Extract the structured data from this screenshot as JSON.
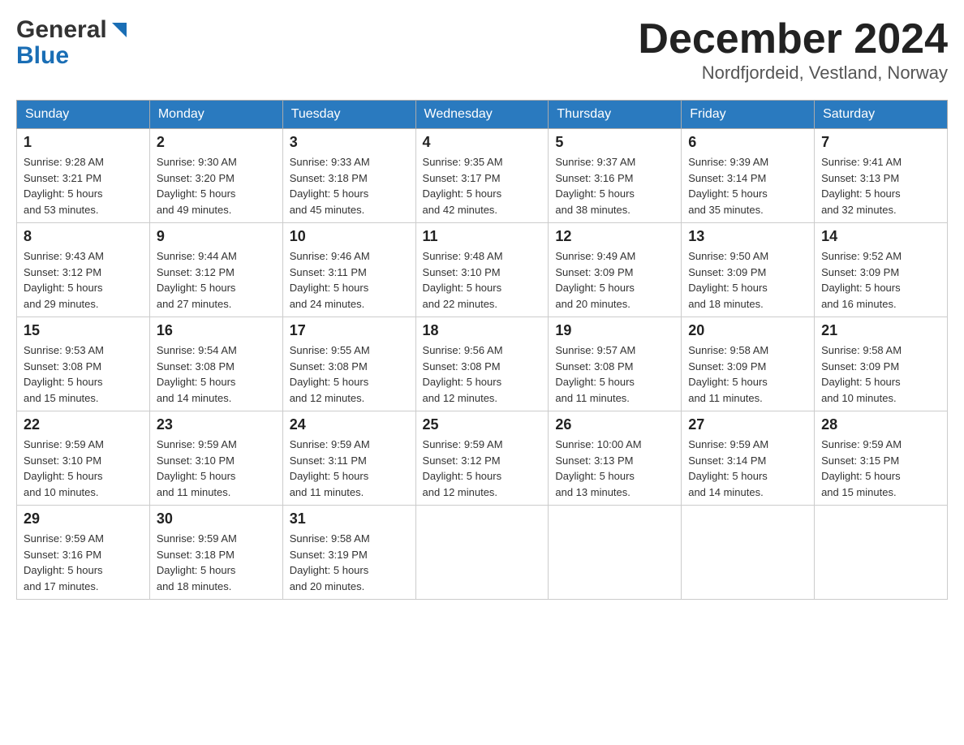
{
  "header": {
    "title": "December 2024",
    "subtitle": "Nordfjordeid, Vestland, Norway",
    "logo_general": "General",
    "logo_blue": "Blue"
  },
  "weekdays": [
    "Sunday",
    "Monday",
    "Tuesday",
    "Wednesday",
    "Thursday",
    "Friday",
    "Saturday"
  ],
  "weeks": [
    [
      {
        "day": "1",
        "sunrise": "9:28 AM",
        "sunset": "3:21 PM",
        "daylight": "5 hours and 53 minutes."
      },
      {
        "day": "2",
        "sunrise": "9:30 AM",
        "sunset": "3:20 PM",
        "daylight": "5 hours and 49 minutes."
      },
      {
        "day": "3",
        "sunrise": "9:33 AM",
        "sunset": "3:18 PM",
        "daylight": "5 hours and 45 minutes."
      },
      {
        "day": "4",
        "sunrise": "9:35 AM",
        "sunset": "3:17 PM",
        "daylight": "5 hours and 42 minutes."
      },
      {
        "day": "5",
        "sunrise": "9:37 AM",
        "sunset": "3:16 PM",
        "daylight": "5 hours and 38 minutes."
      },
      {
        "day": "6",
        "sunrise": "9:39 AM",
        "sunset": "3:14 PM",
        "daylight": "5 hours and 35 minutes."
      },
      {
        "day": "7",
        "sunrise": "9:41 AM",
        "sunset": "3:13 PM",
        "daylight": "5 hours and 32 minutes."
      }
    ],
    [
      {
        "day": "8",
        "sunrise": "9:43 AM",
        "sunset": "3:12 PM",
        "daylight": "5 hours and 29 minutes."
      },
      {
        "day": "9",
        "sunrise": "9:44 AM",
        "sunset": "3:12 PM",
        "daylight": "5 hours and 27 minutes."
      },
      {
        "day": "10",
        "sunrise": "9:46 AM",
        "sunset": "3:11 PM",
        "daylight": "5 hours and 24 minutes."
      },
      {
        "day": "11",
        "sunrise": "9:48 AM",
        "sunset": "3:10 PM",
        "daylight": "5 hours and 22 minutes."
      },
      {
        "day": "12",
        "sunrise": "9:49 AM",
        "sunset": "3:09 PM",
        "daylight": "5 hours and 20 minutes."
      },
      {
        "day": "13",
        "sunrise": "9:50 AM",
        "sunset": "3:09 PM",
        "daylight": "5 hours and 18 minutes."
      },
      {
        "day": "14",
        "sunrise": "9:52 AM",
        "sunset": "3:09 PM",
        "daylight": "5 hours and 16 minutes."
      }
    ],
    [
      {
        "day": "15",
        "sunrise": "9:53 AM",
        "sunset": "3:08 PM",
        "daylight": "5 hours and 15 minutes."
      },
      {
        "day": "16",
        "sunrise": "9:54 AM",
        "sunset": "3:08 PM",
        "daylight": "5 hours and 14 minutes."
      },
      {
        "day": "17",
        "sunrise": "9:55 AM",
        "sunset": "3:08 PM",
        "daylight": "5 hours and 12 minutes."
      },
      {
        "day": "18",
        "sunrise": "9:56 AM",
        "sunset": "3:08 PM",
        "daylight": "5 hours and 12 minutes."
      },
      {
        "day": "19",
        "sunrise": "9:57 AM",
        "sunset": "3:08 PM",
        "daylight": "5 hours and 11 minutes."
      },
      {
        "day": "20",
        "sunrise": "9:58 AM",
        "sunset": "3:09 PM",
        "daylight": "5 hours and 11 minutes."
      },
      {
        "day": "21",
        "sunrise": "9:58 AM",
        "sunset": "3:09 PM",
        "daylight": "5 hours and 10 minutes."
      }
    ],
    [
      {
        "day": "22",
        "sunrise": "9:59 AM",
        "sunset": "3:10 PM",
        "daylight": "5 hours and 10 minutes."
      },
      {
        "day": "23",
        "sunrise": "9:59 AM",
        "sunset": "3:10 PM",
        "daylight": "5 hours and 11 minutes."
      },
      {
        "day": "24",
        "sunrise": "9:59 AM",
        "sunset": "3:11 PM",
        "daylight": "5 hours and 11 minutes."
      },
      {
        "day": "25",
        "sunrise": "9:59 AM",
        "sunset": "3:12 PM",
        "daylight": "5 hours and 12 minutes."
      },
      {
        "day": "26",
        "sunrise": "10:00 AM",
        "sunset": "3:13 PM",
        "daylight": "5 hours and 13 minutes."
      },
      {
        "day": "27",
        "sunrise": "9:59 AM",
        "sunset": "3:14 PM",
        "daylight": "5 hours and 14 minutes."
      },
      {
        "day": "28",
        "sunrise": "9:59 AM",
        "sunset": "3:15 PM",
        "daylight": "5 hours and 15 minutes."
      }
    ],
    [
      {
        "day": "29",
        "sunrise": "9:59 AM",
        "sunset": "3:16 PM",
        "daylight": "5 hours and 17 minutes."
      },
      {
        "day": "30",
        "sunrise": "9:59 AM",
        "sunset": "3:18 PM",
        "daylight": "5 hours and 18 minutes."
      },
      {
        "day": "31",
        "sunrise": "9:58 AM",
        "sunset": "3:19 PM",
        "daylight": "5 hours and 20 minutes."
      },
      null,
      null,
      null,
      null
    ]
  ],
  "labels": {
    "sunrise": "Sunrise:",
    "sunset": "Sunset:",
    "daylight": "Daylight:"
  }
}
